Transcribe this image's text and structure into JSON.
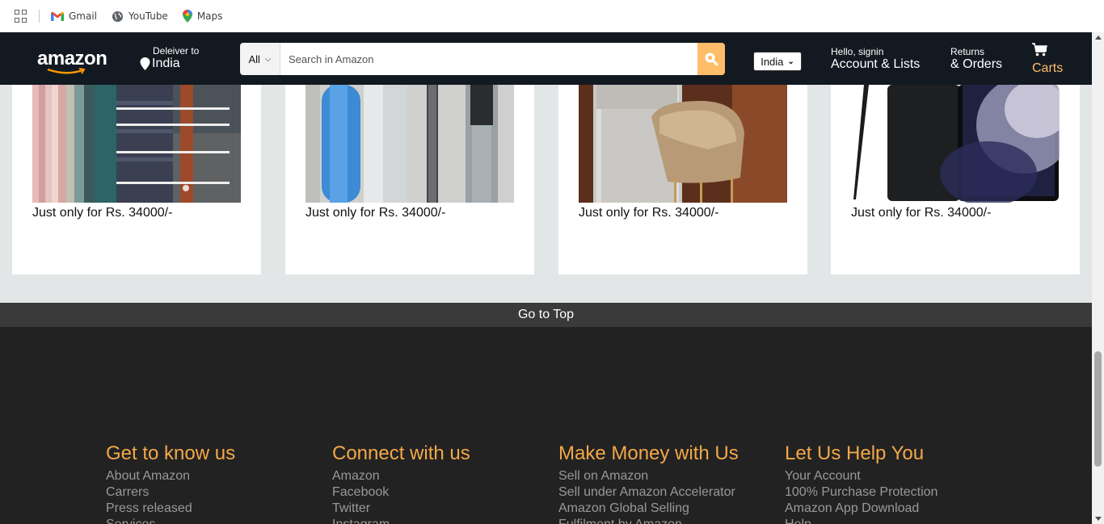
{
  "bookmarks": [
    {
      "label": "Gmail",
      "icon": "gmail-icon"
    },
    {
      "label": "YouTube",
      "icon": "globe-icon"
    },
    {
      "label": "Maps",
      "icon": "maps-pin-icon"
    }
  ],
  "nav": {
    "logo": "amazon",
    "deliver_small": "Deleiver to",
    "deliver_big": "India",
    "search_category": "All",
    "search_placeholder": "Search in Amazon",
    "country_select": "India",
    "account_small": "Hello, signin",
    "account_big": "Account & Lists",
    "returns_small": "Returns",
    "returns_big": "& Orders",
    "cart_label": "Carts"
  },
  "products": [
    {
      "price": "Just only for Rs. 34000/-",
      "image": "hangers-scarves"
    },
    {
      "price": "Just only for Rs. 34000/-",
      "image": "hair-tools"
    },
    {
      "price": "Just only for Rs. 34000/-",
      "image": "chair-desk"
    },
    {
      "price": "Just only for Rs. 34000/-",
      "image": "samsung-phone-stylus"
    }
  ],
  "go_to_top": "Go to Top",
  "footer": {
    "columns": [
      {
        "title": "Get to know us",
        "links": [
          "About Amazon",
          "Carrers",
          "Press released",
          "Services"
        ]
      },
      {
        "title": "Connect with us",
        "links": [
          "Amazon",
          "Facebook",
          "Twitter",
          "Instagram"
        ]
      },
      {
        "title": "Make Money with Us",
        "links": [
          "Sell on Amazon",
          "Sell under Amazon Accelerator",
          "Amazon Global Selling",
          "Fulfilment by Amazon"
        ]
      },
      {
        "title": "Let Us Help You",
        "links": [
          "Your Account",
          "100% Purchase Protection",
          "Amazon App Download",
          "Help"
        ]
      }
    ]
  },
  "colors": {
    "nav_bg": "#131921",
    "accent": "#febd69",
    "footer_heading": "#f3a847",
    "footer_bg": "#222222",
    "section_bg": "#e3e6e6"
  }
}
